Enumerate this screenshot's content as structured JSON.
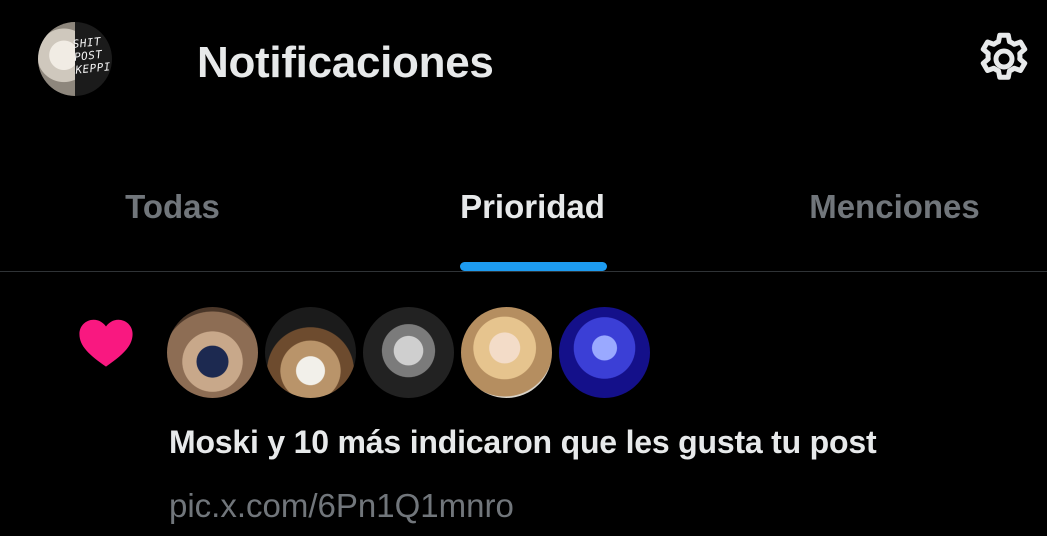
{
  "header": {
    "title": "Notificaciones",
    "avatar_text": "SHIT POST KEPPI",
    "settings_icon": "gear-icon"
  },
  "tabs": [
    {
      "label": "Todas",
      "active": false
    },
    {
      "label": "Prioridad",
      "active": true
    },
    {
      "label": "Menciones",
      "active": false
    }
  ],
  "notification": {
    "icon": "heart-icon",
    "icon_color": "#f91880",
    "text": "Moski y 10 más indicaron que les gusta tu post",
    "link": "pic.x.com/6Pn1Q1mnro",
    "avatars_count": 5
  },
  "colors": {
    "background": "#000000",
    "primary_text": "#e7e9ea",
    "secondary_text": "#71767b",
    "accent": "#1d9bf0",
    "divider": "#2f3336"
  }
}
